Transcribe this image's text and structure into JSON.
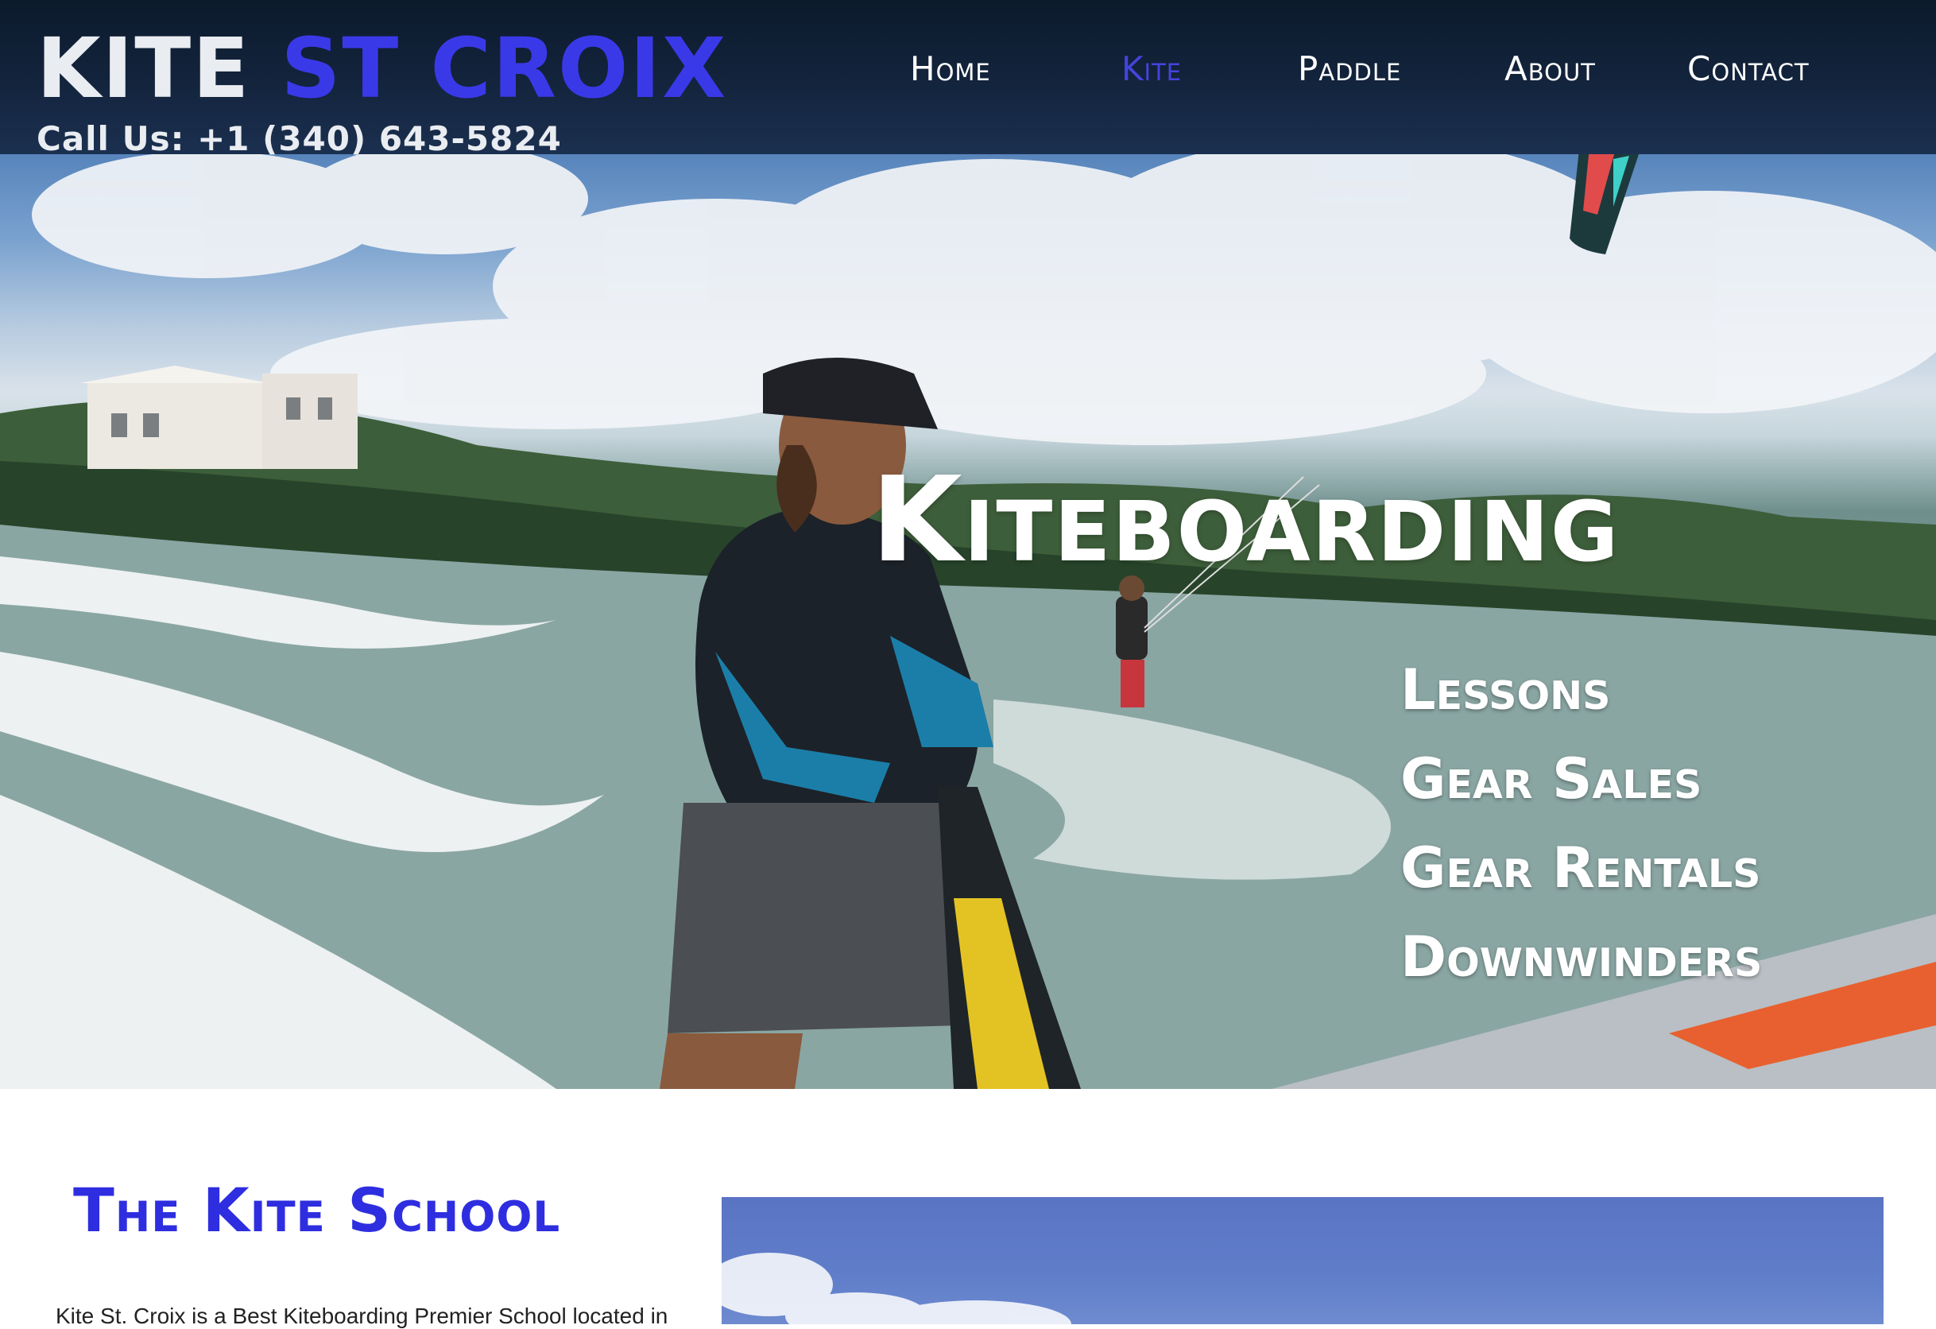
{
  "header": {
    "logo_white": "KITE",
    "logo_blue": "ST CROIX",
    "phone": "Call Us: +1 (340) 643-5824"
  },
  "nav": {
    "items": [
      {
        "label": "Home",
        "active": false
      },
      {
        "label": "Kite",
        "active": true
      },
      {
        "label": "Paddle",
        "active": false
      },
      {
        "label": "About",
        "active": false
      },
      {
        "label": "Contact",
        "active": false
      }
    ]
  },
  "hero": {
    "title": "Kiteboarding",
    "services": [
      "Lessons",
      "Gear Sales",
      "Gear Rentals",
      "Downwinders"
    ]
  },
  "school": {
    "title": "The Kite School",
    "intro": "Kite St. Croix is a Best Kiteboarding Premier School located in"
  },
  "colors": {
    "accent_blue": "#3a39e8",
    "header_bg": "#13243d",
    "text_white": "#ffffff"
  }
}
